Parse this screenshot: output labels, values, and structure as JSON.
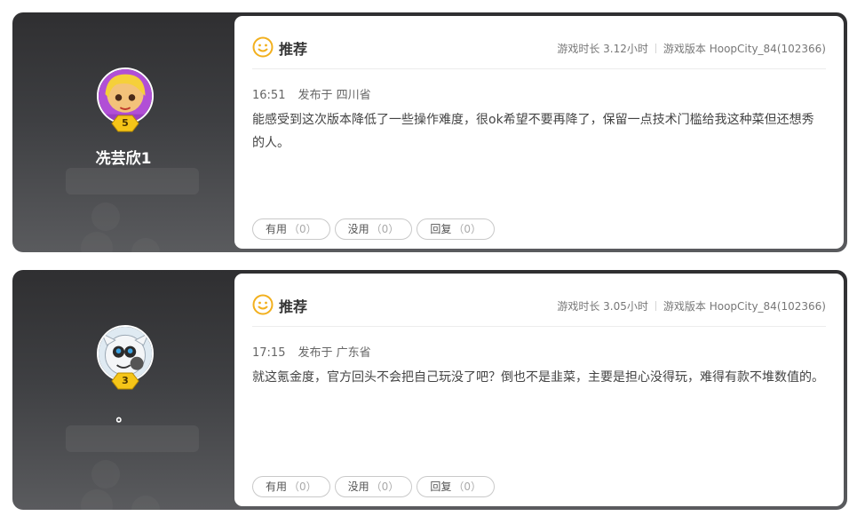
{
  "reviews": [
    {
      "username": "冼芸欣1",
      "level": "5",
      "recommend_label": "推荐",
      "playtime": "游戏时长 3.12小时",
      "version": "游戏版本 HoopCity_84(102366)",
      "time": "16:51",
      "location": "发布于 四川省",
      "content": "能感受到这次版本降低了一些操作难度，很ok希望不要再降了，保留一点技术门槛给我这种菜但还想秀的人。",
      "actions": [
        {
          "label": "有用",
          "count": "（0）"
        },
        {
          "label": "没用",
          "count": "（0）"
        },
        {
          "label": "回复",
          "count": "（0）"
        }
      ]
    },
    {
      "username": "。",
      "level": "3",
      "recommend_label": "推荐",
      "playtime": "游戏时长 3.05小时",
      "version": "游戏版本 HoopCity_84(102366)",
      "time": "17:15",
      "location": "发布于 广东省",
      "content": "就这氪金度，官方回头不会把自己玩没了吧？倒也不是韭菜，主要是担心没得玩，难得有款不堆数值的。",
      "actions": [
        {
          "label": "有用",
          "count": "（0）"
        },
        {
          "label": "没用",
          "count": "（0）"
        },
        {
          "label": "回复",
          "count": "（0）"
        }
      ]
    }
  ],
  "colors": {
    "recommend_icon": "#f2b01e",
    "level_badge": "#f5c518",
    "panel_dark": "#2f2f31"
  },
  "icons": [
    "smile-icon",
    "level-badge-icon",
    "user-avatar"
  ]
}
